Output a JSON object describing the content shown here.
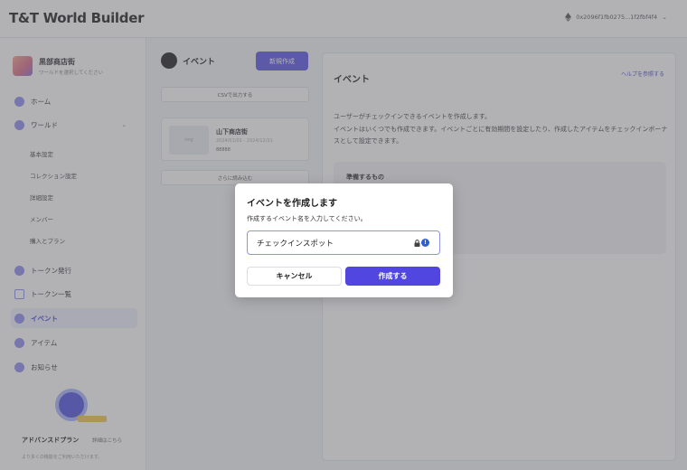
{
  "app": {
    "logo": "T&T World Builder"
  },
  "header": {
    "account_id": "0x2096f1fb0275...1f2fbf4f4"
  },
  "sidebar": {
    "project_name": "黒部商店街",
    "project_sub": "ワールドを選択してください",
    "items": [
      {
        "label": "ホーム"
      },
      {
        "label": "ワールド"
      },
      {
        "label": "トークン発行"
      },
      {
        "label": "トークン一覧"
      },
      {
        "label": "イベント"
      },
      {
        "label": "アイテム"
      },
      {
        "label": "お知らせ"
      }
    ],
    "sub_items": [
      {
        "label": "基本設定"
      },
      {
        "label": "コレクション設定"
      },
      {
        "label": "詳細設定"
      },
      {
        "label": "メンバー"
      },
      {
        "label": "購入とプラン"
      }
    ],
    "promo": {
      "title": "アドバンスドプラン",
      "link": "詳細はこちら",
      "desc": "より多くの機能をご利用いただけます。"
    }
  },
  "middle": {
    "title": "イベント",
    "new_button": "新規作成",
    "csv_button": "CSVで出力する",
    "card": {
      "title": "山下商店街",
      "sub": "2024/01/01 - 2024/12/31",
      "count": "88888"
    },
    "more_button": "さらに読み込む"
  },
  "panel": {
    "title": "イベント",
    "help": "ヘルプを参照する",
    "desc1": "ユーザーがチェックインできるイベントを作成します。",
    "desc2": "イベントはいくつでも作成できます。イベントごとに有効期間を設定したり、作成したアイテムをチェックインボーナスとして設定できます。",
    "box_title": "準備するもの"
  },
  "modal": {
    "title": "イベントを作成します",
    "desc": "作成するイベント名を入力してください。",
    "input_value": "チェックインスポット",
    "cancel": "キャンセル",
    "create": "作成する"
  }
}
